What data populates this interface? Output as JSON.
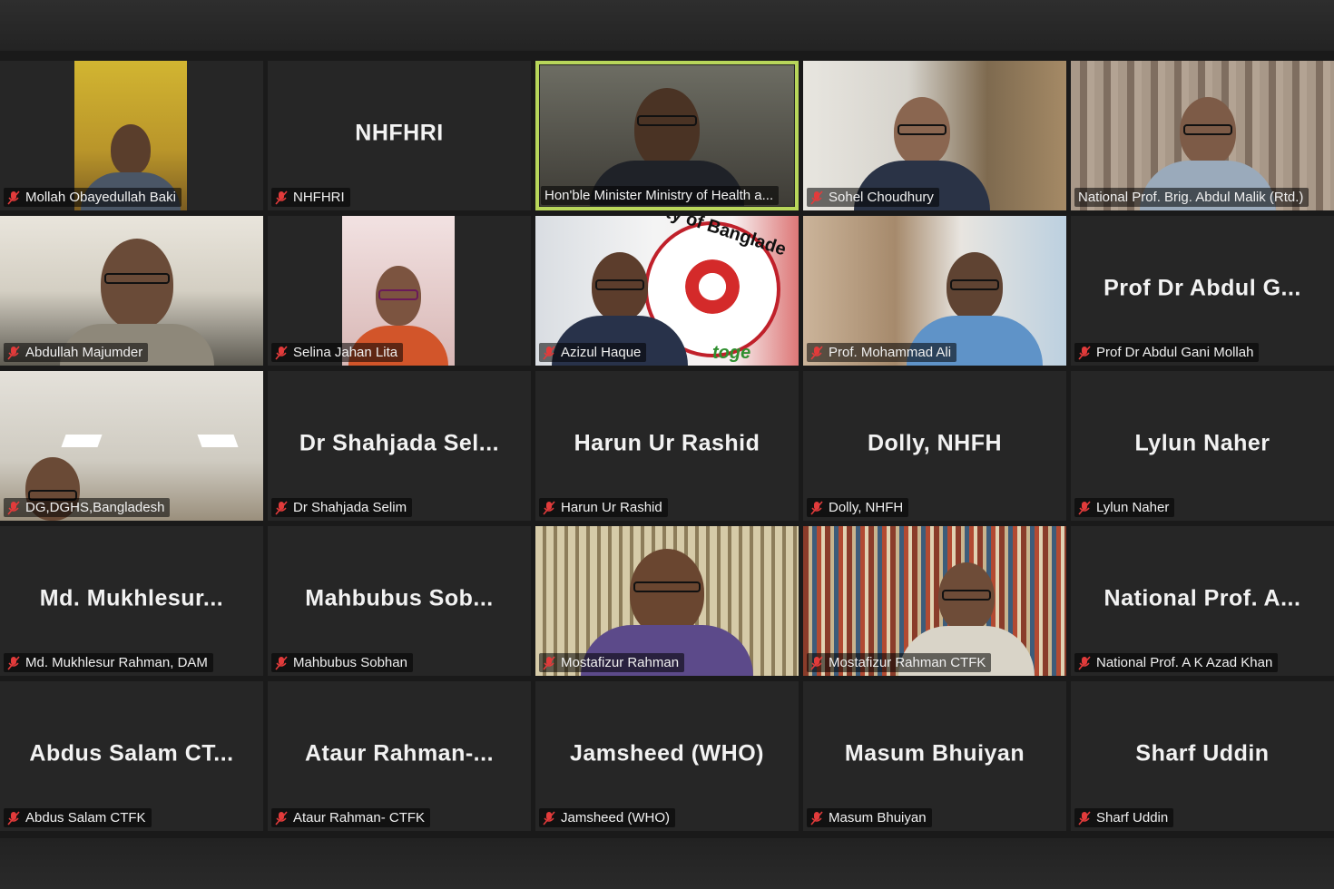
{
  "colors": {
    "active_speaker_border": "#b8d65a",
    "muted_icon": "#e23b3b",
    "tile_bg": "#262626"
  },
  "tiles": [
    {
      "label": "Mollah Obayedullah Baki",
      "display_name": "",
      "muted": true,
      "video": true
    },
    {
      "label": "NHFHRI",
      "display_name": "NHFHRI",
      "muted": true,
      "video": false
    },
    {
      "label": "Hon'ble Minister  Ministry of Health a...",
      "display_name": "",
      "muted": false,
      "video": true,
      "speaking": true
    },
    {
      "label": "Sohel Choudhury",
      "display_name": "",
      "muted": true,
      "video": true
    },
    {
      "label": "National Prof. Brig. Abdul Malik (Rtd.)",
      "display_name": "",
      "muted": false,
      "video": true
    },
    {
      "label": "Abdullah Majumder",
      "display_name": "",
      "muted": true,
      "video": true
    },
    {
      "label": "Selina Jahan Lita",
      "display_name": "",
      "muted": true,
      "video": true
    },
    {
      "label": "Azizul Haque",
      "display_name": "",
      "muted": true,
      "video": true,
      "backdrop_text": "ety of Banglade",
      "backdrop_text2": "toge"
    },
    {
      "label": "Prof. Mohammad Ali",
      "display_name": "",
      "muted": true,
      "video": true
    },
    {
      "label": "Prof Dr Abdul Gani Mollah",
      "display_name": "Prof Dr Abdul G...",
      "muted": true,
      "video": false
    },
    {
      "label": "DG,DGHS,Bangladesh",
      "display_name": "",
      "muted": true,
      "video": true
    },
    {
      "label": "Dr Shahjada Selim",
      "display_name": "Dr Shahjada Sel...",
      "muted": true,
      "video": false
    },
    {
      "label": "Harun Ur Rashid",
      "display_name": "Harun Ur Rashid",
      "muted": true,
      "video": false
    },
    {
      "label": "Dolly, NHFH",
      "display_name": "Dolly, NHFH",
      "muted": true,
      "video": false
    },
    {
      "label": "Lylun Naher",
      "display_name": "Lylun Naher",
      "muted": true,
      "video": false
    },
    {
      "label": "Md. Mukhlesur Rahman, DAM",
      "display_name": "Md. Mukhlesur...",
      "muted": true,
      "video": false
    },
    {
      "label": "Mahbubus Sobhan",
      "display_name": "Mahbubus Sob...",
      "muted": true,
      "video": false
    },
    {
      "label": "Mostafizur Rahman",
      "display_name": "",
      "muted": true,
      "video": true
    },
    {
      "label": "Mostafizur Rahman CTFK",
      "display_name": "",
      "muted": true,
      "video": true
    },
    {
      "label": "National Prof. A K Azad Khan",
      "display_name": "National Prof. A...",
      "muted": true,
      "video": false
    },
    {
      "label": "Abdus Salam CTFK",
      "display_name": "Abdus Salam CT...",
      "muted": true,
      "video": false
    },
    {
      "label": "Ataur Rahman- CTFK",
      "display_name": "Ataur Rahman-...",
      "muted": true,
      "video": false
    },
    {
      "label": "Jamsheed (WHO)",
      "display_name": "Jamsheed (WHO)",
      "muted": true,
      "video": false
    },
    {
      "label": "Masum Bhuiyan",
      "display_name": "Masum Bhuiyan",
      "muted": true,
      "video": false
    },
    {
      "label": "Sharf Uddin",
      "display_name": "Sharf Uddin",
      "muted": true,
      "video": false
    }
  ]
}
